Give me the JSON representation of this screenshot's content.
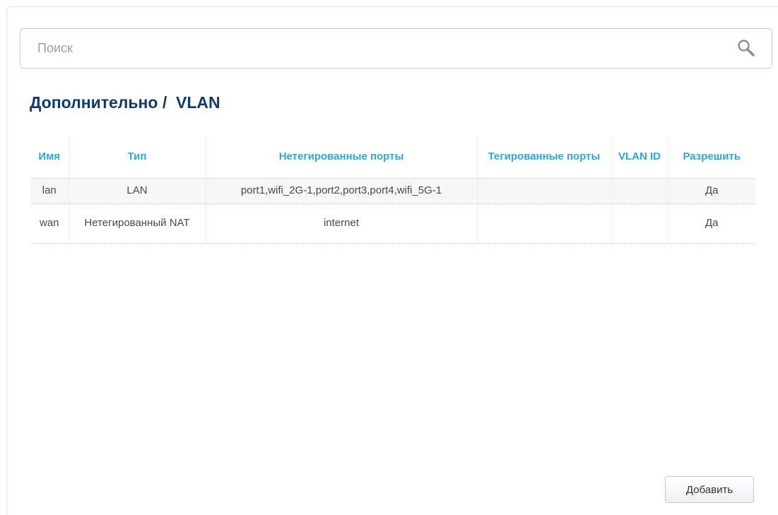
{
  "search": {
    "placeholder": "Поиск",
    "value": "",
    "icon": "search-icon"
  },
  "page": {
    "title": "Дополнительно /  VLAN"
  },
  "table": {
    "headers": {
      "name": "Имя",
      "type": "Тип",
      "untagged": "Нетегированные порты",
      "tagged": "Тегированные порты",
      "vlan_id": "VLAN ID",
      "enable": "Разрешить"
    },
    "rows": [
      {
        "name": "lan",
        "type": "LAN",
        "untagged": "port1,wifi_2G-1,port2,port3,port4,wifi_5G-1",
        "tagged": "",
        "vlan_id": "",
        "enable": "Да"
      },
      {
        "name": "wan",
        "type": "Нетегированный NAT",
        "untagged": "internet",
        "tagged": "",
        "vlan_id": "",
        "enable": "Да"
      }
    ]
  },
  "actions": {
    "add_label": "Добавить"
  },
  "colors": {
    "title": "#0e3a73",
    "header": "#29a8e6",
    "row_alt": "#f6f6f6"
  }
}
